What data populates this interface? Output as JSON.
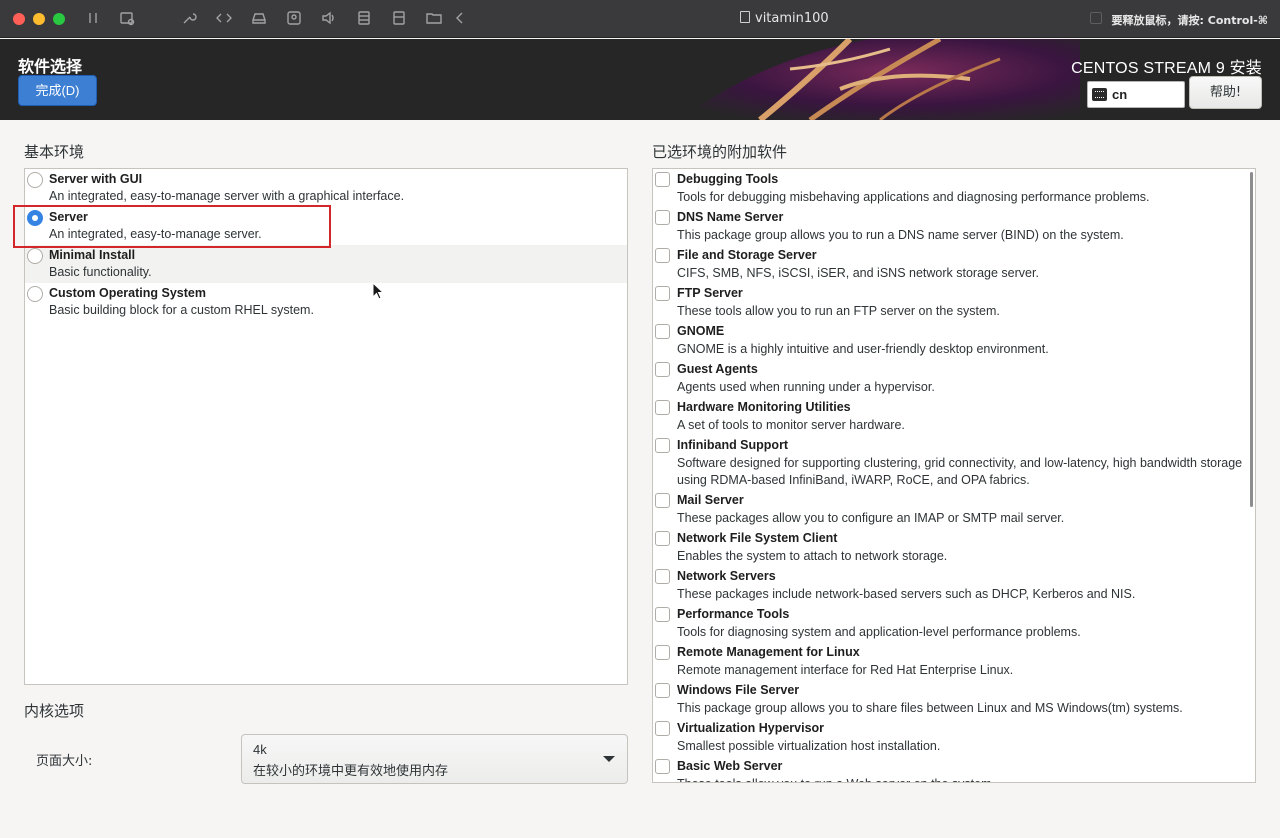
{
  "window": {
    "title": "vitamin100",
    "release_hint": "要释放鼠标，请按: Control-⌘"
  },
  "header": {
    "spoke_title": "软件选择",
    "done_label": "完成(D)",
    "product_title": "CENTOS STREAM 9 安装",
    "keyboard_layout": "cn",
    "help_label": "帮助!"
  },
  "base_environment": {
    "label": "基本环境",
    "items": [
      {
        "title": "Server with GUI",
        "desc": "An integrated, easy-to-manage server with a graphical interface.",
        "selected": false
      },
      {
        "title": "Server",
        "desc": "An integrated, easy-to-manage server.",
        "selected": true
      },
      {
        "title": "Minimal Install",
        "desc": "Basic functionality.",
        "selected": false
      },
      {
        "title": "Custom Operating System",
        "desc": "Basic building block for a custom RHEL system.",
        "selected": false
      }
    ]
  },
  "addons": {
    "label": "已选环境的附加软件",
    "items": [
      {
        "title": "Debugging Tools",
        "desc": "Tools for debugging misbehaving applications and diagnosing performance problems.",
        "checked": false
      },
      {
        "title": "DNS Name Server",
        "desc": "This package group allows you to run a DNS name server (BIND) on the system.",
        "checked": false
      },
      {
        "title": "File and Storage Server",
        "desc": "CIFS, SMB, NFS, iSCSI, iSER, and iSNS network storage server.",
        "checked": false
      },
      {
        "title": "FTP Server",
        "desc": "These tools allow you to run an FTP server on the system.",
        "checked": false
      },
      {
        "title": "GNOME",
        "desc": "GNOME is a highly intuitive and user-friendly desktop environment.",
        "checked": false
      },
      {
        "title": "Guest Agents",
        "desc": "Agents used when running under a hypervisor.",
        "checked": false
      },
      {
        "title": "Hardware Monitoring Utilities",
        "desc": "A set of tools to monitor server hardware.",
        "checked": false
      },
      {
        "title": "Infiniband Support",
        "desc": "Software designed for supporting clustering, grid connectivity, and low-latency, high bandwidth storage using RDMA-based InfiniBand, iWARP, RoCE, and OPA fabrics.",
        "checked": false
      },
      {
        "title": "Mail Server",
        "desc": "These packages allow you to configure an IMAP or SMTP mail server.",
        "checked": false
      },
      {
        "title": "Network File System Client",
        "desc": "Enables the system to attach to network storage.",
        "checked": false
      },
      {
        "title": "Network Servers",
        "desc": "These packages include network-based servers such as DHCP, Kerberos and NIS.",
        "checked": false
      },
      {
        "title": "Performance Tools",
        "desc": "Tools for diagnosing system and application-level performance problems.",
        "checked": false
      },
      {
        "title": "Remote Management for Linux",
        "desc": "Remote management interface for Red Hat Enterprise Linux.",
        "checked": false
      },
      {
        "title": "Windows File Server",
        "desc": "This package group allows you to share files between Linux and MS Windows(tm) systems.",
        "checked": false
      },
      {
        "title": "Virtualization Hypervisor",
        "desc": "Smallest possible virtualization host installation.",
        "checked": false
      },
      {
        "title": "Basic Web Server",
        "desc": "These tools allow you to run a Web server on the system.",
        "checked": false
      }
    ]
  },
  "kernel": {
    "label": "内核选项",
    "page_size_label": "页面大小:",
    "page_size_value": "4k",
    "page_size_desc": "在较小的环境中更有效地使用内存"
  },
  "colors": {
    "accent": "#3c7fd3",
    "highlight_box": "#d3262a",
    "header_bg": "#262626"
  }
}
